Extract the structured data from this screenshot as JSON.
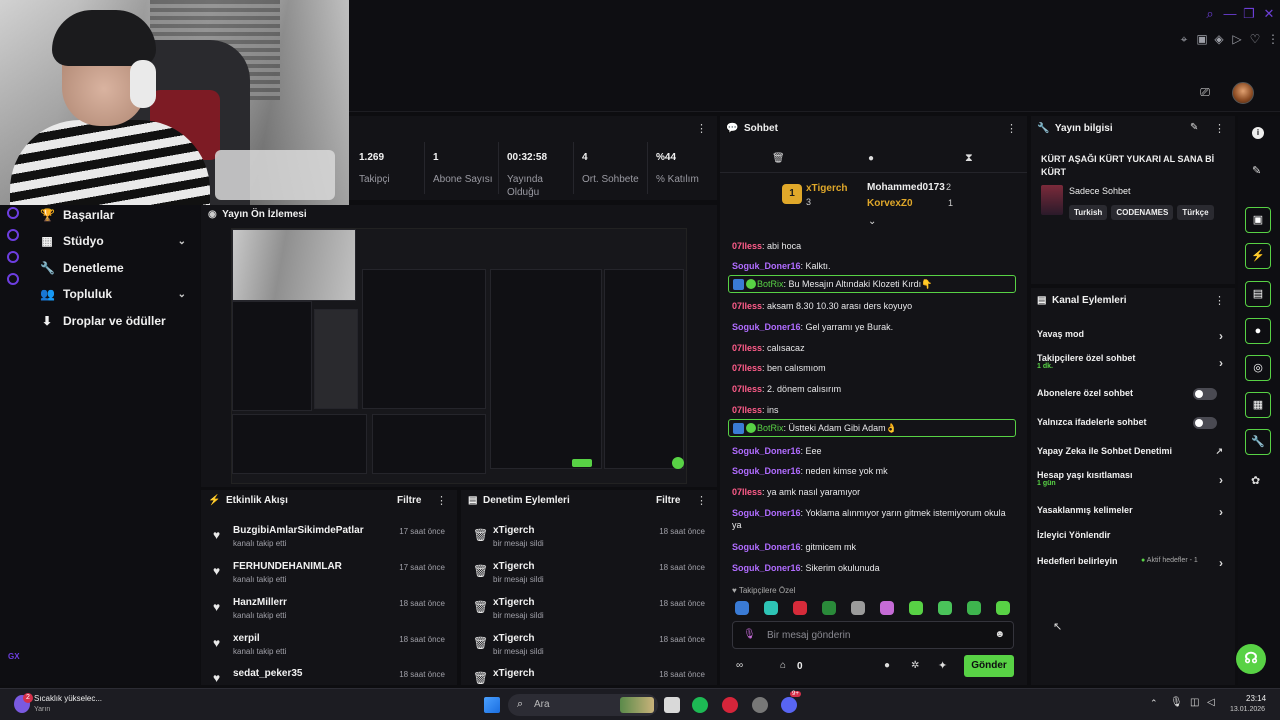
{
  "stats": [
    {
      "value": "1.269",
      "label": "Takipçi"
    },
    {
      "value": "1",
      "label": "Abone Sayısı"
    },
    {
      "value": "00:32:58",
      "label": "Yayında Olduğu"
    },
    {
      "value": "4",
      "label": "Ort. Sohbete"
    },
    {
      "value": "%44",
      "label": "% Katılım"
    }
  ],
  "nav": {
    "items": [
      {
        "label": "Başarılar"
      },
      {
        "label": "Stüdyo"
      },
      {
        "label": "Denetleme"
      },
      {
        "label": "Topluluk"
      },
      {
        "label": "Droplar ve ödüller"
      }
    ],
    "rail_label": "GX"
  },
  "preview": {
    "title": "Yayın Ön İzlemesi"
  },
  "activity": {
    "title": "Etkinlik Akışı",
    "filter": "Filtre",
    "rows": [
      {
        "name": "BuzgibiAmlarSikimdePatlar",
        "sub": "kanalı takip etti",
        "time": "17 saat önce"
      },
      {
        "name": "FERHUNDEHANIMLAR",
        "sub": "kanalı takip etti",
        "time": "17 saat önce"
      },
      {
        "name": "HanzMillerr",
        "sub": "kanalı takip etti",
        "time": "18 saat önce"
      },
      {
        "name": "xerpil",
        "sub": "kanalı takip etti",
        "time": "18 saat önce"
      },
      {
        "name": "sedat_peker35",
        "sub": "",
        "time": "18 saat önce"
      }
    ]
  },
  "moderation": {
    "title": "Denetim Eylemleri",
    "filter": "Filtre",
    "rows": [
      {
        "name": "xTigerch",
        "sub": "bir mesajı sildi",
        "time": "18 saat önce"
      },
      {
        "name": "xTigerch",
        "sub": "bir mesajı sildi",
        "time": "18 saat önce"
      },
      {
        "name": "xTigerch",
        "sub": "bir mesajı sildi",
        "time": "18 saat önce"
      },
      {
        "name": "xTigerch",
        "sub": "bir mesajı sildi",
        "time": "18 saat önce"
      },
      {
        "name": "xTigerch",
        "sub": "",
        "time": "18 saat önce"
      }
    ]
  },
  "chat": {
    "title": "Sohbet",
    "leaders": {
      "first": {
        "rank": "1",
        "name": "xTigerch",
        "count": "3"
      },
      "second": {
        "name": "Mohammed0173",
        "count": "2"
      },
      "third": {
        "name": "KorvexZ0",
        "count": "1"
      }
    },
    "messages": [
      {
        "user": "07lless",
        "text": "abi hoca",
        "color": "#ff5c8a"
      },
      {
        "user": "Soguk_Doner16",
        "text": "Kalktı.",
        "color": "#b06cff"
      },
      {
        "user": "BotRix",
        "text": "Bu Mesajın Altındaki Klozeti Kırdı👇",
        "color": "#58d245",
        "bot": true
      },
      {
        "user": "07lless",
        "text": "aksam 8.30 10.30 arası ders koyuyo",
        "color": "#ff5c8a"
      },
      {
        "user": "Soguk_Doner16",
        "text": "Gel yarramı ye Burak.",
        "color": "#b06cff"
      },
      {
        "user": "07lless",
        "text": "calısacaz",
        "color": "#ff5c8a"
      },
      {
        "user": "07lless",
        "text": "ben calısmıom",
        "color": "#ff5c8a"
      },
      {
        "user": "07lless",
        "text": "2. dönem calısırım",
        "color": "#ff5c8a"
      },
      {
        "user": "07lless",
        "text": "ins",
        "color": "#ff5c8a"
      },
      {
        "user": "BotRix",
        "text": "Üstteki Adam Gibi Adam👌",
        "color": "#58d245",
        "bot": true
      },
      {
        "user": "Soguk_Doner16",
        "text": "Eee",
        "color": "#b06cff"
      },
      {
        "user": "Soguk_Doner16",
        "text": "neden kimse yok mk",
        "color": "#b06cff"
      },
      {
        "user": "07lless",
        "text": "ya amk nasıl yaramıyor",
        "color": "#ff5c8a"
      },
      {
        "user": "Soguk_Doner16",
        "text": "Yoklama alınmıyor yarın gitmek istemiyorum okula ya",
        "color": "#b06cff"
      },
      {
        "user": "Soguk_Doner16",
        "text": "gitmicem mk",
        "color": "#b06cff"
      },
      {
        "user": "Soguk_Doner16",
        "text": "Sikerim okulunuda",
        "color": "#b06cff"
      }
    ],
    "emote_section": "Takipçilere Özel",
    "input_placeholder": "Bir mesaj gönderin",
    "gift_count": "0",
    "send_label": "Gönder"
  },
  "stream_info": {
    "title": "Yayın bilgisi",
    "stream_title": "KÜRT AŞAĞI KÜRT YUKARI AL SANA Bİ KÜRT",
    "category": "Sadece Sohbet",
    "tags": [
      "Turkish",
      "CODENAMES",
      "Türkçe"
    ]
  },
  "channel_actions": {
    "title": "Kanal Eylemleri",
    "items": [
      {
        "label": "Yavaş mod",
        "kind": "chevron"
      },
      {
        "label": "Takipçilere özel sohbet",
        "sub": "1 dk.",
        "kind": "chevron"
      },
      {
        "label": "Abonelere özel sohbet",
        "kind": "toggle"
      },
      {
        "label": "Yalnızca ifadelerle sohbet",
        "kind": "toggle"
      },
      {
        "label": "Yapay Zeka ile Sohbet Denetimi",
        "kind": "external"
      },
      {
        "label": "Hesap yaşı kısıtlaması",
        "sub": "1 gün",
        "kind": "chevron"
      },
      {
        "label": "Yasaklanmış kelimeler",
        "kind": "chevron"
      },
      {
        "label": "İzleyici Yönlendir",
        "kind": "none"
      },
      {
        "label": "Hedefleri belirleyin",
        "extra": "Aktif hedefler - 1",
        "kind": "chevron"
      }
    ]
  },
  "taskbar": {
    "weather_title": "Sıcaklık yükselec...",
    "weather_sub": "Yarın",
    "search_placeholder": "Ara",
    "time": "23:14",
    "date": "13.01.2026",
    "notification_badge": "2",
    "discord_badge": "9+"
  },
  "colors": {
    "accent": "#58d245",
    "rail": "#6d3ee0"
  }
}
